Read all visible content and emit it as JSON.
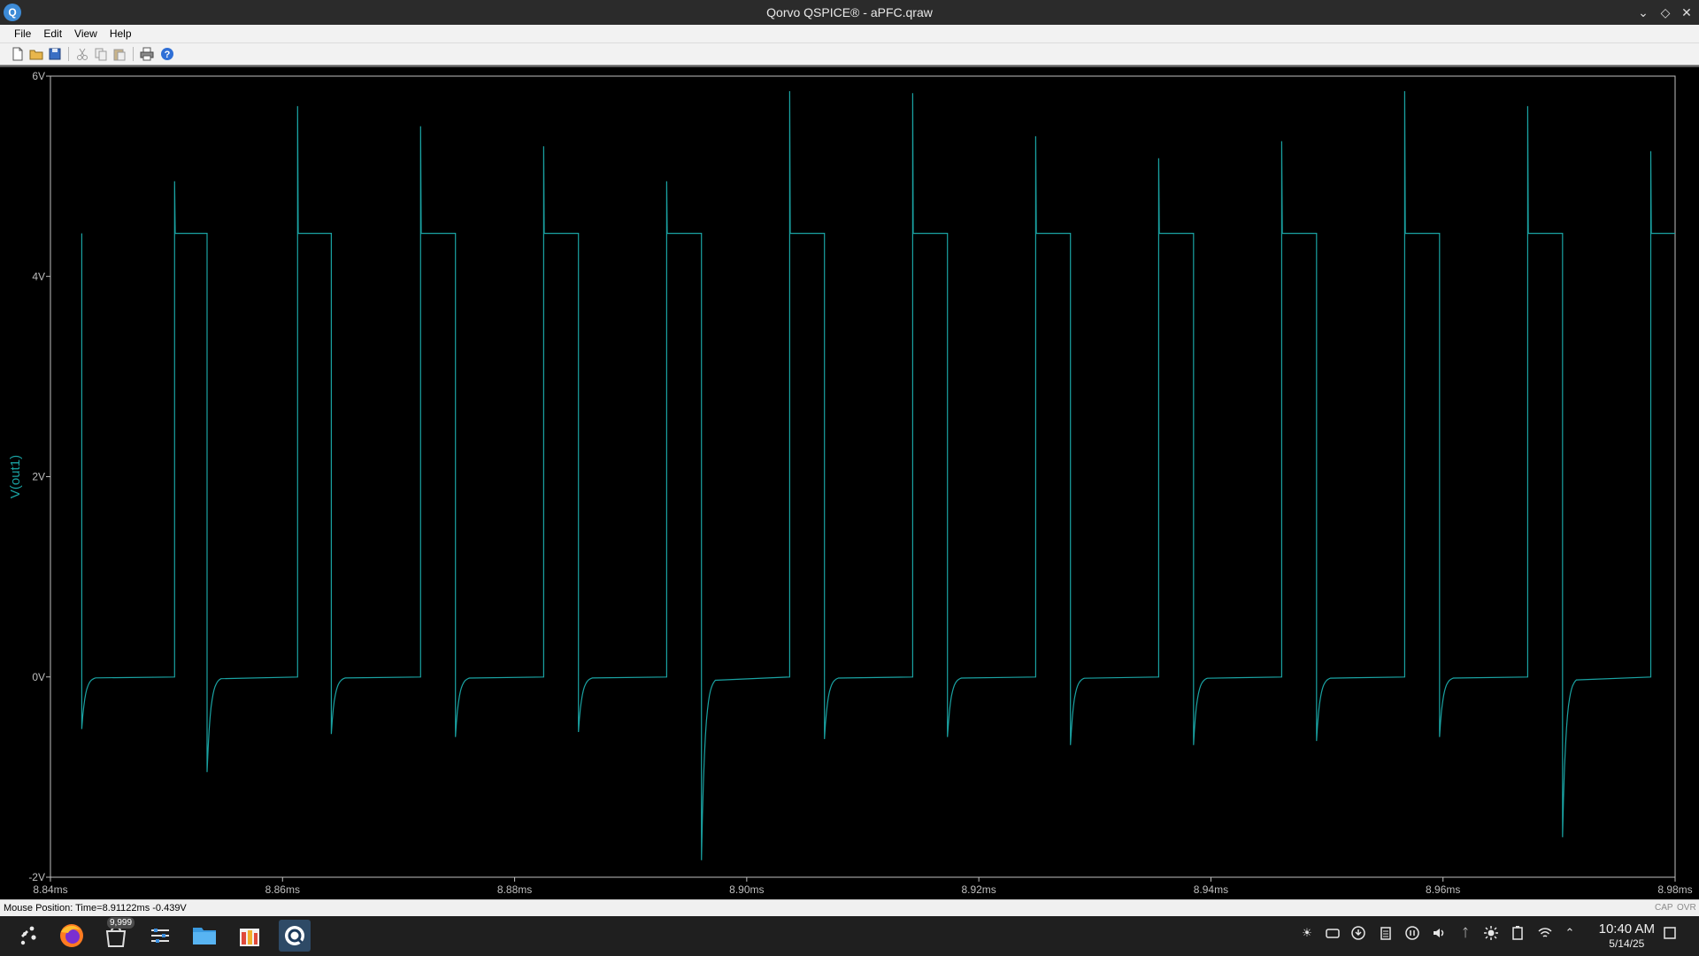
{
  "window": {
    "title": "Qorvo QSPICE® - aPFC.qraw",
    "app_icon_letter": "Q"
  },
  "menu": [
    "File",
    "Edit",
    "View",
    "Help"
  ],
  "toolbar": [
    "new-file-icon",
    "open-folder-icon",
    "save-icon",
    "cut-icon",
    "copy-icon",
    "paste-icon",
    "print-icon",
    "help-icon"
  ],
  "status": {
    "text": "Mouse Position: Time=8.91122ms -0.439V",
    "cap": "CAP",
    "ovr": "OVR"
  },
  "taskbar": {
    "badge": "9,999",
    "clock_time": "10:40 AM",
    "clock_date": "5/14/25"
  },
  "colors": {
    "trace": "#1aa3a3",
    "axis": "#bfbfbf",
    "background": "#000000"
  },
  "chart_data": {
    "type": "line",
    "title": "",
    "xlabel": "",
    "ylabel": "V(out1)",
    "x_unit": "ms",
    "y_unit": "V",
    "xlim": [
      8.84,
      8.98
    ],
    "ylim": [
      -2,
      6
    ],
    "x_ticks": [
      8.84,
      8.86,
      8.88,
      8.9,
      8.92,
      8.94,
      8.96,
      8.98
    ],
    "x_tick_labels": [
      "8.84ms",
      "8.86ms",
      "8.88ms",
      "8.90ms",
      "8.92ms",
      "8.94ms",
      "8.96ms",
      "8.98ms"
    ],
    "y_ticks": [
      6,
      4,
      2,
      0,
      -2
    ],
    "y_tick_labels": [
      "6V",
      "4V",
      "2V",
      "0V",
      "-2V"
    ],
    "grid": false,
    "series": [
      {
        "name": "V(out1)",
        "high_level_V": 4.43,
        "low_level_V": 0.0,
        "cycles": [
          {
            "high_start_ms": 8.8427,
            "fall_ms": 8.8427,
            "fall_min_V": -0.52,
            "rise_ms": 8.8507,
            "rise_peak_V": 4.95,
            "high_end_ms": 8.8515
          },
          {
            "high_start_ms": 8.8507,
            "fall_ms": 8.8535,
            "fall_min_V": -0.95,
            "rise_ms": 8.8613,
            "rise_peak_V": 5.7,
            "high_end_ms": 8.8625
          },
          {
            "high_start_ms": 8.8613,
            "fall_ms": 8.8642,
            "fall_min_V": -0.57,
            "rise_ms": 8.8719,
            "rise_peak_V": 5.5,
            "high_end_ms": 8.8731
          },
          {
            "high_start_ms": 8.8719,
            "fall_ms": 8.8749,
            "fall_min_V": -0.6,
            "rise_ms": 8.8825,
            "rise_peak_V": 5.3,
            "high_end_ms": 8.8838
          },
          {
            "high_start_ms": 8.8825,
            "fall_ms": 8.8855,
            "fall_min_V": -0.55,
            "rise_ms": 8.8931,
            "rise_peak_V": 4.95,
            "high_end_ms": 8.8944
          },
          {
            "high_start_ms": 8.8931,
            "fall_ms": 8.8961,
            "fall_min_V": -1.83,
            "rise_ms": 8.9037,
            "rise_peak_V": 5.85,
            "high_end_ms": 8.905
          },
          {
            "high_start_ms": 8.9037,
            "fall_ms": 8.9067,
            "fall_min_V": -0.62,
            "rise_ms": 8.9143,
            "rise_peak_V": 5.83,
            "high_end_ms": 8.9157
          },
          {
            "high_start_ms": 8.9143,
            "fall_ms": 8.9173,
            "fall_min_V": -0.6,
            "rise_ms": 8.9249,
            "rise_peak_V": 5.4,
            "high_end_ms": 8.9262
          },
          {
            "high_start_ms": 8.9249,
            "fall_ms": 8.9279,
            "fall_min_V": -0.68,
            "rise_ms": 8.9355,
            "rise_peak_V": 5.18,
            "high_end_ms": 8.9366
          },
          {
            "high_start_ms": 8.9355,
            "fall_ms": 8.9385,
            "fall_min_V": -0.68,
            "rise_ms": 8.9461,
            "rise_peak_V": 5.35,
            "high_end_ms": 8.9473
          },
          {
            "high_start_ms": 8.9461,
            "fall_ms": 8.9491,
            "fall_min_V": -0.64,
            "rise_ms": 8.9567,
            "rise_peak_V": 5.85,
            "high_end_ms": 8.958
          },
          {
            "high_start_ms": 8.9567,
            "fall_ms": 8.9597,
            "fall_min_V": -0.6,
            "rise_ms": 8.9673,
            "rise_peak_V": 5.7,
            "high_end_ms": 8.9686
          },
          {
            "high_start_ms": 8.9673,
            "fall_ms": 8.9703,
            "fall_min_V": -1.6,
            "rise_ms": 8.9779,
            "rise_peak_V": 5.25,
            "high_end_ms": 8.98
          }
        ]
      }
    ]
  }
}
